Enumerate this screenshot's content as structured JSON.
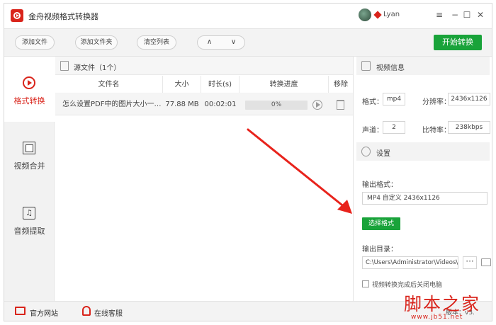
{
  "titlebar": {
    "app_title": "金舟视频格式转换器",
    "username": "Lyan",
    "menu_icon": "≡",
    "min_icon": "−",
    "max_icon": "☐",
    "close_icon": "✕"
  },
  "toolbar": {
    "add_file": "添加文件",
    "add_folder": "添加文件夹",
    "clear_list": "清空列表",
    "up_arrow": "∧",
    "down_arrow": "∨",
    "start_convert": "开始转换"
  },
  "sidebar": {
    "items": [
      {
        "label": "格式转换",
        "active": true
      },
      {
        "label": "视频合并",
        "active": false
      },
      {
        "label": "音频提取",
        "active": false
      }
    ],
    "audio_glyph": "♫"
  },
  "file_list": {
    "source_title": "源文件（1个）",
    "columns": [
      "文件名",
      "大小",
      "时长(s)",
      "转换进度",
      "移除"
    ],
    "rows": [
      {
        "name": "怎么设置PDF中的图片大小一…",
        "size": "77.88 MB",
        "duration": "00:02:01",
        "progress": "0%",
        "progress_value": 0
      }
    ]
  },
  "video_info": {
    "title": "视频信息",
    "format_label": "格式：",
    "format_value": "mp4",
    "resolution_label": "分辨率：",
    "resolution_value": "2436x1126",
    "channels_label": "声道：",
    "channels_value": "2",
    "bitrate_label": "比特率：",
    "bitrate_value": "238kbps"
  },
  "settings": {
    "title": "设置",
    "output_format_label": "输出格式：",
    "output_format_value": "MP4 自定义 2436x1126",
    "select_format_button": "选择格式",
    "output_dir_label": "输出目录：",
    "output_dir_value": "C:\\Users\\Administrator\\Videos\\",
    "browse_label": "···",
    "shutdown_label": "视频转换完成后关闭电脑",
    "shutdown_checked": false
  },
  "footer": {
    "website": "官方网站",
    "support": "在线客服",
    "version": "版本：v3."
  },
  "watermark": {
    "main": "脚本之家",
    "sub": "www.jb51.net"
  },
  "colors": {
    "brand_red": "#d9241b",
    "accent_green": "#19a33a",
    "annotation_arrow": "#e8231c"
  }
}
